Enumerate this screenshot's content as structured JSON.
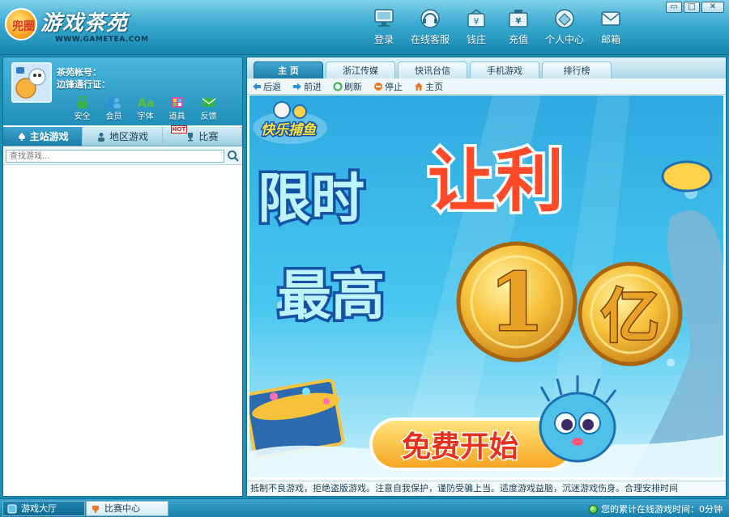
{
  "app": {
    "logo_title": "游戏茶苑",
    "logo_seal": "兜圈",
    "logo_domain": "WWW.GAMETEA.COM"
  },
  "window_controls": {
    "minimize": "▭",
    "restore": "□",
    "close": "✕"
  },
  "top_nav": [
    {
      "label": "登录",
      "icon": "monitor-icon"
    },
    {
      "label": "在线客服",
      "icon": "headset-icon"
    },
    {
      "label": "钱庄",
      "icon": "bank-icon"
    },
    {
      "label": "充值",
      "icon": "recharge-icon"
    },
    {
      "label": "个人中心",
      "icon": "personal-center-icon"
    },
    {
      "label": "邮箱",
      "icon": "mail-icon"
    }
  ],
  "user": {
    "account_label": "茶苑帐号：",
    "pass_label": "边锋通行证："
  },
  "user_tools": [
    {
      "label": "安全",
      "icon": "lock-icon",
      "color": "#3bb14a"
    },
    {
      "label": "会员",
      "icon": "members-icon",
      "color": "#2f8fd8"
    },
    {
      "label": "字体",
      "icon": "font-icon",
      "color": "#5bbf3a"
    },
    {
      "label": "道具",
      "icon": "props-icon",
      "color": "#d74fa8"
    },
    {
      "label": "反馈",
      "icon": "feedback-icon",
      "color": "#37b34a"
    }
  ],
  "game_tabs": [
    {
      "label": "主站游戏",
      "icon": "spade-icon",
      "active": true
    },
    {
      "label": "地区游戏",
      "icon": "person-icon",
      "active": false
    },
    {
      "label": "比赛",
      "icon": "trophy-icon",
      "active": false,
      "badge": "HOT"
    }
  ],
  "search": {
    "placeholder": "查找游戏..."
  },
  "page_tabs": [
    {
      "label": "主 页",
      "active": true
    },
    {
      "label": "浙江传媒"
    },
    {
      "label": "快讯台信"
    },
    {
      "label": "手机游戏"
    },
    {
      "label": "排行榜"
    }
  ],
  "browse": {
    "back": "后退",
    "forward": "前进",
    "refresh": "刷新",
    "stop": "停止",
    "home": "主页"
  },
  "banner": {
    "logo": "快乐捕鱼",
    "line1a": "限时",
    "line1b": "让利",
    "line2": "最高",
    "coin1": "1",
    "coin2": "亿",
    "cta": "免费开始"
  },
  "ticker": "抵制不良游戏，拒绝盗版游戏。注意自我保护，谨防受骗上当。适度游戏益脑，沉迷游戏伤身。合理安排时间",
  "status": {
    "tabs": [
      {
        "label": "游戏大厅",
        "active": true
      },
      {
        "label": "比赛中心",
        "active": false
      }
    ],
    "online_text": "您的累计在线游戏时间：0分钟"
  },
  "colors": {
    "frame_blue": "#1d8fb3",
    "accent_orange": "#f7a823",
    "banner_red": "#e8321e"
  }
}
